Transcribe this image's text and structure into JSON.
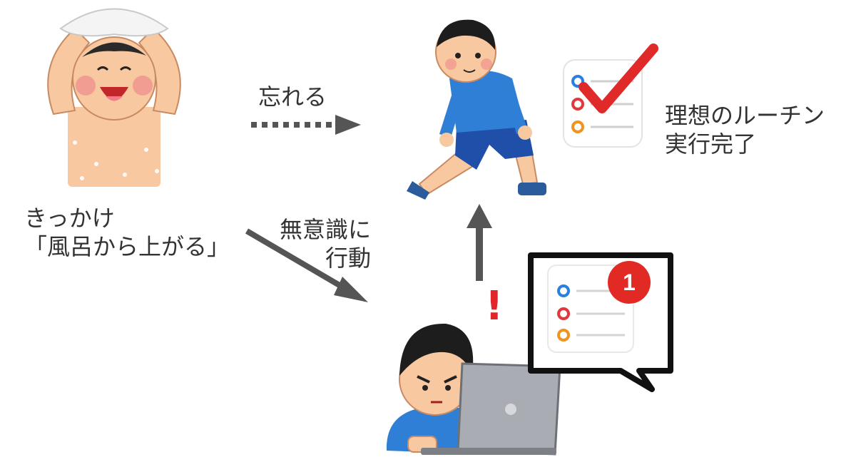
{
  "labels": {
    "trigger_line1": "きっかけ",
    "trigger_line2": "「風呂から上がる」",
    "forget": "忘れる",
    "unconscious_line1": "無意識に",
    "unconscious_line2": "行動",
    "ideal_line1": "理想のルーチン",
    "ideal_line2": "実行完了",
    "exclamation": "!"
  },
  "notification": {
    "badge_count": "1"
  },
  "colors": {
    "arrow_gray": "#555555",
    "dot_blue": "#2b7fe0",
    "dot_red": "#e0383c",
    "dot_orange": "#f0941e",
    "check_red": "#e02a2a",
    "badge_red": "#e22a25",
    "skin": "#f8c8a0"
  },
  "icons": [
    "bath-boy-icon",
    "stretching-boy-icon",
    "laptop-boy-icon",
    "checklist-icon",
    "notification-bubble-icon"
  ]
}
